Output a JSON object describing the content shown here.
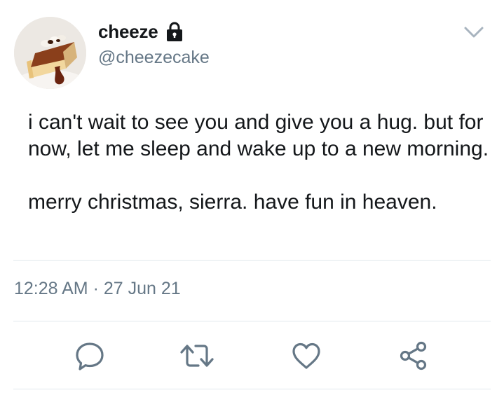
{
  "user": {
    "display_name": "cheeze",
    "handle": "@cheezecake",
    "protected_icon": "lock-icon",
    "avatar": "cheesecake-avatar"
  },
  "menu": {
    "icon": "chevron-down-icon"
  },
  "tweet": {
    "paragraphs": [
      "i can't wait to see you and give you a hug. but for now, let me sleep and wake up to a new morning.",
      "merry christmas, sierra. have fun in heaven."
    ],
    "time": "12:28 AM",
    "separator": "·",
    "date": "27 Jun 21"
  },
  "actions": {
    "reply_icon": "reply-icon",
    "retweet_icon": "retweet-icon",
    "like_icon": "heart-icon",
    "share_icon": "share-icon"
  },
  "colors": {
    "text": "#14171a",
    "secondary_text": "#657786",
    "divider": "#e1e8ed",
    "icon": "#657786"
  }
}
